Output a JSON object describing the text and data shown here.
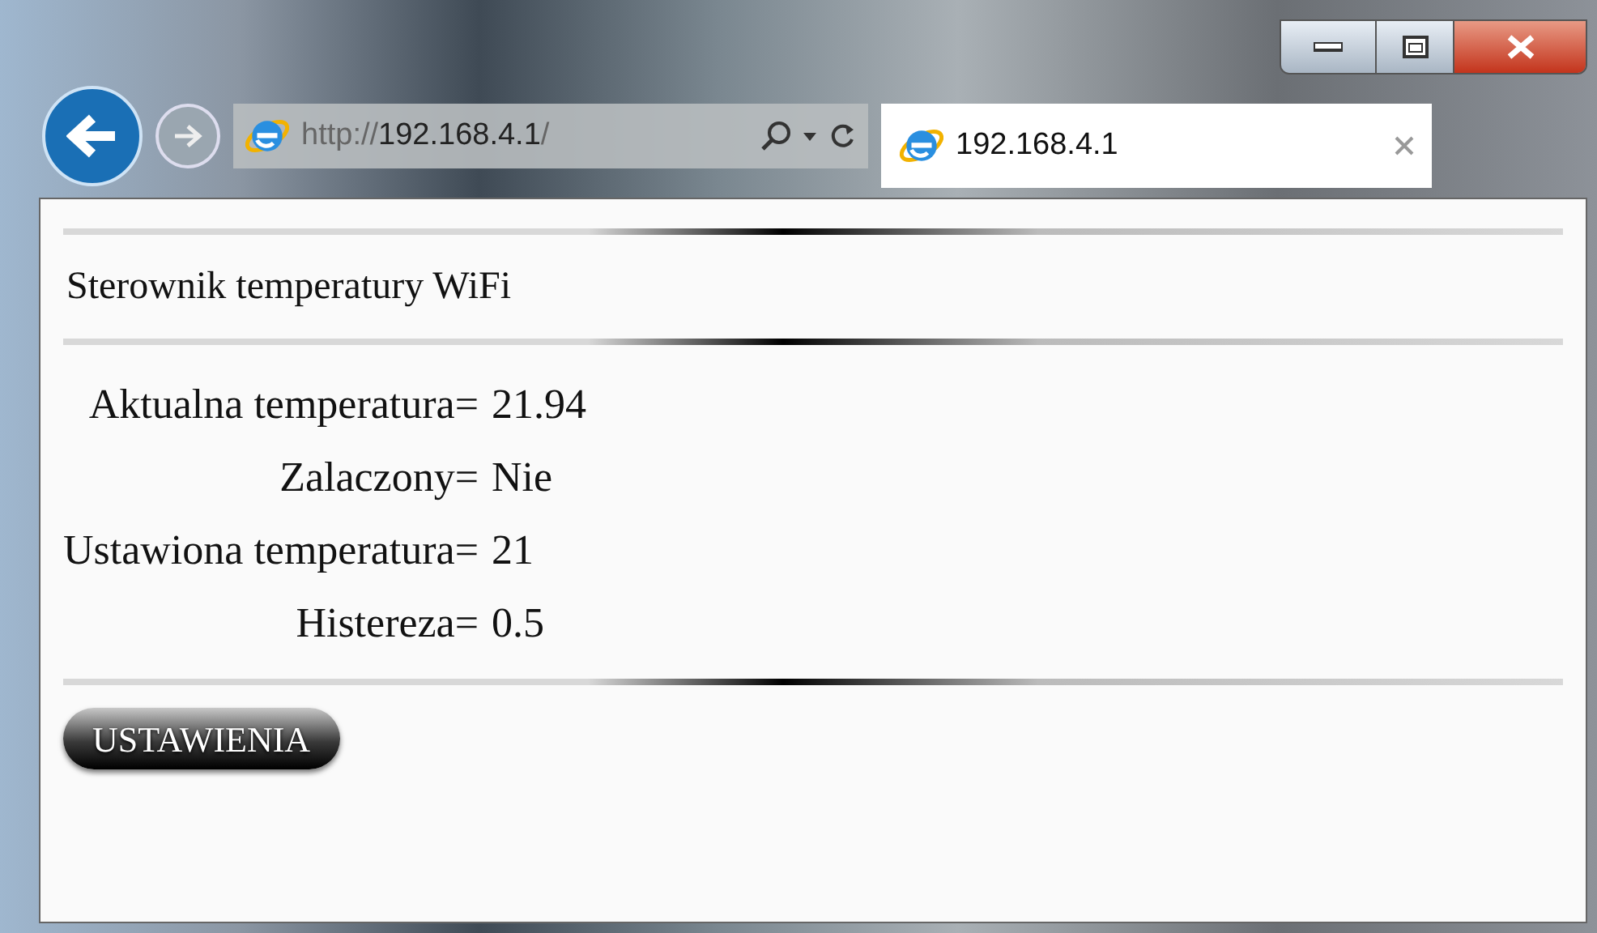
{
  "browser": {
    "address": {
      "scheme": "http://",
      "host": "192.168.4.1",
      "path": "/"
    },
    "tab": {
      "title": "192.168.4.1",
      "selected": true
    }
  },
  "page": {
    "title": "Sterownik temperatury WiFi",
    "rows": [
      {
        "label": "Aktualna temperatura=",
        "value": "21.94"
      },
      {
        "label": "Zalaczony=",
        "value": "Nie"
      },
      {
        "label": "Ustawiona temperatura=",
        "value": "21"
      },
      {
        "label": "Histereza=",
        "value": "0.5"
      }
    ],
    "button": "USTAWIENIA"
  }
}
